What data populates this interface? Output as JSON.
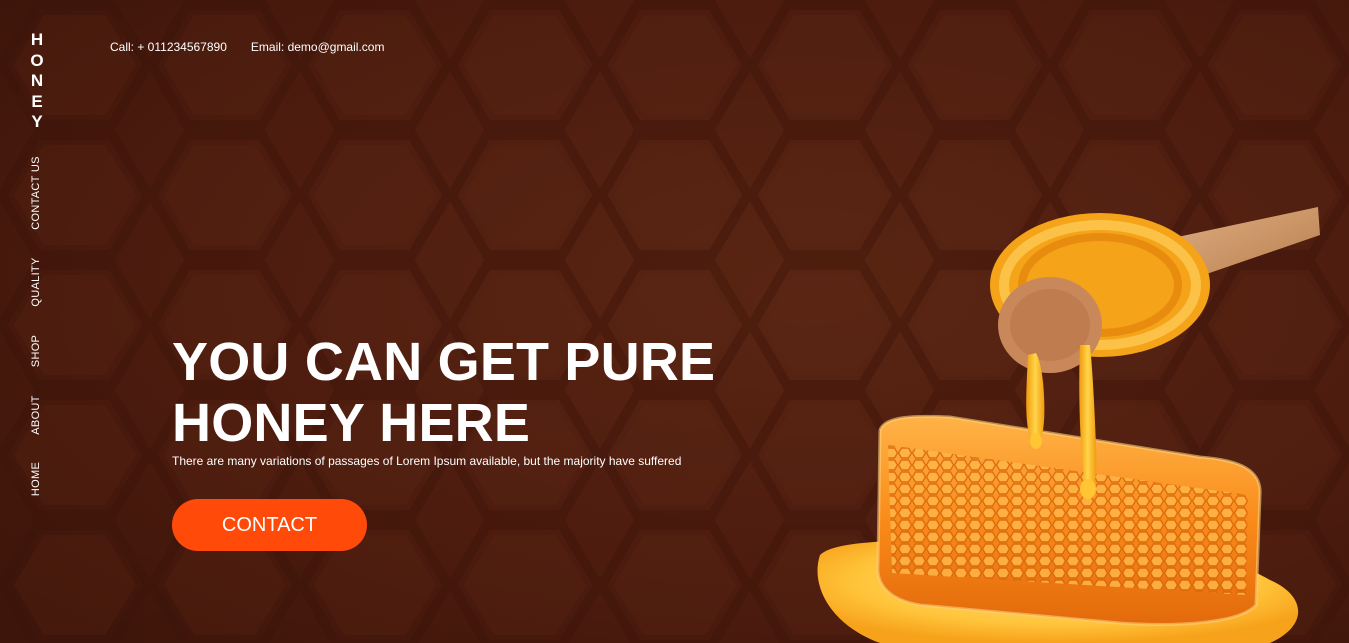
{
  "brand": {
    "letters": [
      "H",
      "O",
      "N",
      "E",
      "Y"
    ]
  },
  "nav": {
    "contact_us": "CONTACT US",
    "quality": "QUALITY",
    "shop": "SHOP",
    "about": "ABOUT",
    "home": "HOME"
  },
  "topbar": {
    "phone": "Call: + 011234567890",
    "email": "Email: demo@gmail.com"
  },
  "hero": {
    "title_line1": "YOU CAN GET PURE",
    "title_line2": "HONEY HERE",
    "subtitle": "There are many variations of passages of Lorem Ipsum available, but the majority have suffered",
    "cta_label": "CONTACT"
  },
  "colors": {
    "background": "#4b1b0e",
    "accent": "#ff4a0a",
    "text": "#ffffff"
  }
}
